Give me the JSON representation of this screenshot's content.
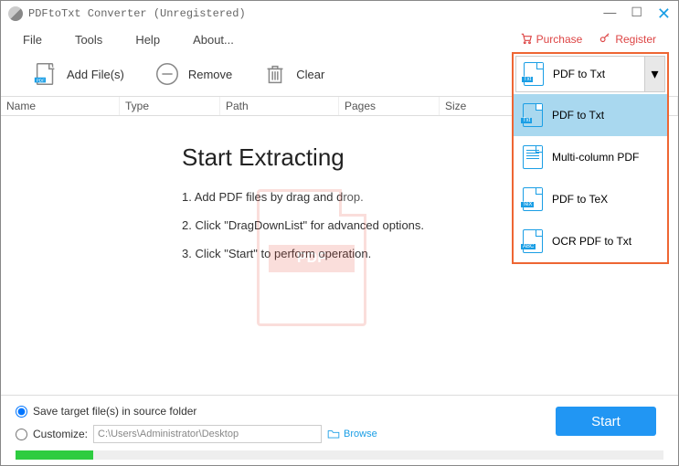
{
  "window": {
    "title": "PDFtoTxt Converter (Unregistered)"
  },
  "menu": {
    "file": "File",
    "tools": "Tools",
    "help": "Help",
    "about": "About...",
    "purchase": "Purchase",
    "register": "Register"
  },
  "toolbar": {
    "add": "Add File(s)",
    "remove": "Remove",
    "clear": "Clear"
  },
  "columns": {
    "name": "Name",
    "type": "Type",
    "path": "Path",
    "pages": "Pages",
    "size": "Size"
  },
  "hero": {
    "title": "Start Extracting",
    "step1": "1. Add PDF files by drag and drop.",
    "step2": "2. Click \"DragDownList\" for advanced options.",
    "step3": "3. Click \"Start\" to perform operation."
  },
  "dropdown": {
    "selected": "PDF to Txt",
    "items": [
      {
        "label": "PDF to Txt",
        "tag": "Txt"
      },
      {
        "label": "Multi-column PDF",
        "tag": ""
      },
      {
        "label": "PDF to TeX",
        "tag": "TeX"
      },
      {
        "label": "OCR PDF to Txt",
        "tag": "ABC"
      }
    ]
  },
  "footer": {
    "opt1": "Save target file(s) in source folder",
    "opt2": "Customize:",
    "path": "C:\\Users\\Administrator\\Desktop",
    "browse": "Browse",
    "start": "Start"
  },
  "watermark": "PDF"
}
